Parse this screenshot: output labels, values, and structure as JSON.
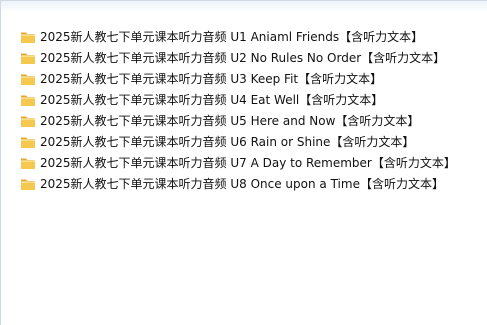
{
  "files": [
    {
      "icon": "folder-icon",
      "name": "2025新人教七下单元课本听力音频 U1 Aniaml Friends【含听力文本】"
    },
    {
      "icon": "folder-icon",
      "name": "2025新人教七下单元课本听力音频 U2 No  Rules No Order【含听力文本】"
    },
    {
      "icon": "folder-icon",
      "name": "2025新人教七下单元课本听力音频 U3 Keep Fit【含听力文本】"
    },
    {
      "icon": "folder-icon",
      "name": "2025新人教七下单元课本听力音频 U4 Eat Well【含听力文本】"
    },
    {
      "icon": "folder-icon",
      "name": "2025新人教七下单元课本听力音频 U5 Here and Now【含听力文本】"
    },
    {
      "icon": "folder-icon",
      "name": "2025新人教七下单元课本听力音频 U6 Rain or Shine【含听力文本】"
    },
    {
      "icon": "folder-icon",
      "name": "2025新人教七下单元课本听力音频 U7 A Day to Remember【含听力文本】"
    },
    {
      "icon": "folder-icon",
      "name": "2025新人教七下单元课本听力音频 U8 Once upon a Time【含听力文本】"
    }
  ],
  "colors": {
    "folder_front": "#f5c94f",
    "folder_back": "#e0aa2f",
    "text": "#111111"
  }
}
